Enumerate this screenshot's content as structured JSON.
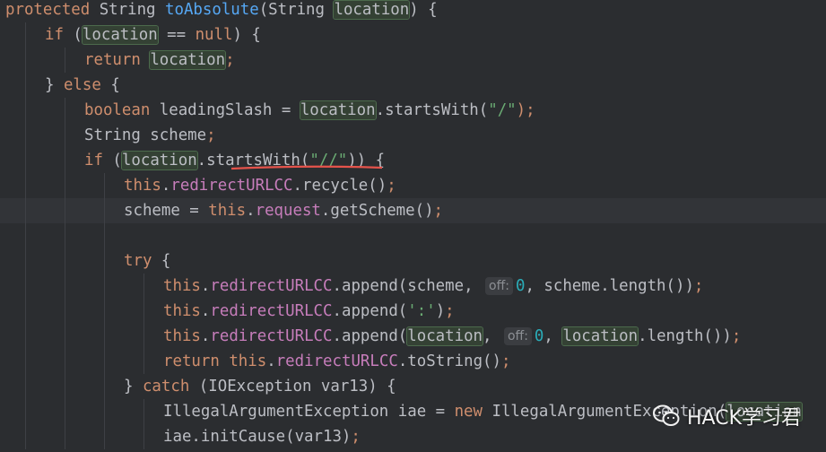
{
  "editor": {
    "lines": [
      {
        "indent": 0,
        "current": false,
        "tokens": [
          {
            "t": "protected",
            "c": "kw"
          },
          {
            "t": " String "
          },
          {
            "t": "toAbsolute",
            "c": "fn"
          },
          {
            "t": "(String "
          },
          {
            "t": "location",
            "c": "hl"
          },
          {
            "t": ") {"
          }
        ]
      },
      {
        "indent": 1,
        "current": false,
        "tokens": [
          {
            "t": "if",
            "c": "kw"
          },
          {
            "t": " ("
          },
          {
            "t": "location",
            "c": "hl"
          },
          {
            "t": " == "
          },
          {
            "t": "null",
            "c": "kw"
          },
          {
            "t": ") {"
          }
        ]
      },
      {
        "indent": 2,
        "current": false,
        "tokens": [
          {
            "t": "return",
            "c": "kw"
          },
          {
            "t": " "
          },
          {
            "t": "location",
            "c": "hl"
          },
          {
            "t": ";",
            "c": "kw"
          }
        ]
      },
      {
        "indent": 1,
        "current": false,
        "tokens": [
          {
            "t": "} "
          },
          {
            "t": "else",
            "c": "kw"
          },
          {
            "t": " {"
          }
        ]
      },
      {
        "indent": 2,
        "current": false,
        "tokens": [
          {
            "t": "boolean",
            "c": "kw"
          },
          {
            "t": " leadingSlash = "
          },
          {
            "t": "location",
            "c": "hl"
          },
          {
            "t": ".startsWith("
          },
          {
            "t": "\"/\"",
            "c": "str"
          },
          {
            "t": ");",
            "c": "kw"
          }
        ]
      },
      {
        "indent": 2,
        "current": false,
        "tokens": [
          {
            "t": "String scheme"
          },
          {
            "t": ";",
            "c": "kw"
          }
        ]
      },
      {
        "indent": 2,
        "current": false,
        "tokens": [
          {
            "t": "if",
            "c": "kw"
          },
          {
            "t": " ("
          },
          {
            "t": "location",
            "c": "hl"
          },
          {
            "t": ".startsWith("
          },
          {
            "t": "\"//\"",
            "c": "str"
          },
          {
            "t": ")) {"
          }
        ]
      },
      {
        "indent": 3,
        "current": false,
        "tokens": [
          {
            "t": "this",
            "c": "kw"
          },
          {
            "t": "."
          },
          {
            "t": "redirectURLCC",
            "c": "fld"
          },
          {
            "t": ".recycle()"
          },
          {
            "t": ";",
            "c": "kw"
          }
        ]
      },
      {
        "indent": 3,
        "current": true,
        "tokens": [
          {
            "t": "scheme = "
          },
          {
            "t": "this",
            "c": "kw"
          },
          {
            "t": "."
          },
          {
            "t": "request",
            "c": "fld"
          },
          {
            "t": ".getScheme()"
          },
          {
            "t": ";",
            "c": "kw"
          }
        ]
      },
      {
        "indent": 3,
        "current": false,
        "tokens": []
      },
      {
        "indent": 3,
        "current": false,
        "tokens": [
          {
            "t": "try",
            "c": "kw"
          },
          {
            "t": " {"
          }
        ]
      },
      {
        "indent": 4,
        "current": false,
        "tokens": [
          {
            "t": "this",
            "c": "kw"
          },
          {
            "t": "."
          },
          {
            "t": "redirectURLCC",
            "c": "fld"
          },
          {
            "t": ".append(scheme, "
          },
          {
            "t": "off:",
            "c": "hint"
          },
          {
            "t": "0",
            "c": "num"
          },
          {
            "t": ", scheme.length())"
          },
          {
            "t": ";",
            "c": "kw"
          }
        ]
      },
      {
        "indent": 4,
        "current": false,
        "tokens": [
          {
            "t": "this",
            "c": "kw"
          },
          {
            "t": "."
          },
          {
            "t": "redirectURLCC",
            "c": "fld"
          },
          {
            "t": ".append("
          },
          {
            "t": "':'",
            "c": "str"
          },
          {
            "t": ")"
          },
          {
            "t": ";",
            "c": "kw"
          }
        ]
      },
      {
        "indent": 4,
        "current": false,
        "tokens": [
          {
            "t": "this",
            "c": "kw"
          },
          {
            "t": "."
          },
          {
            "t": "redirectURLCC",
            "c": "fld"
          },
          {
            "t": ".append("
          },
          {
            "t": "location",
            "c": "hl"
          },
          {
            "t": ", "
          },
          {
            "t": "off:",
            "c": "hint"
          },
          {
            "t": "0",
            "c": "num"
          },
          {
            "t": ", "
          },
          {
            "t": "location",
            "c": "hl"
          },
          {
            "t": ".length())"
          },
          {
            "t": ";",
            "c": "kw"
          }
        ]
      },
      {
        "indent": 4,
        "current": false,
        "tokens": [
          {
            "t": "return",
            "c": "kw"
          },
          {
            "t": " "
          },
          {
            "t": "this",
            "c": "kw"
          },
          {
            "t": "."
          },
          {
            "t": "redirectURLCC",
            "c": "fld"
          },
          {
            "t": ".toString()"
          },
          {
            "t": ";",
            "c": "kw"
          }
        ]
      },
      {
        "indent": 3,
        "current": false,
        "tokens": [
          {
            "t": "} "
          },
          {
            "t": "catch",
            "c": "kw"
          },
          {
            "t": " (IOException var13) {"
          }
        ]
      },
      {
        "indent": 4,
        "current": false,
        "tokens": [
          {
            "t": "IllegalArgumentException iae = "
          },
          {
            "t": "new",
            "c": "kw"
          },
          {
            "t": " IllegalArgumentException("
          },
          {
            "t": "location",
            "c": "hl"
          }
        ]
      },
      {
        "indent": 4,
        "current": false,
        "tokens": [
          {
            "t": "iae.initCause(var13)"
          },
          {
            "t": ";",
            "c": "kw"
          }
        ]
      }
    ]
  },
  "watermark": {
    "label": "HACK学习君",
    "icon": "wechat-icon"
  },
  "colors": {
    "background": "#2b2d30",
    "keyword": "#cf8e6d",
    "method": "#56a8f5",
    "field": "#c77dbb",
    "string": "#6aab73",
    "number": "#2aacb8",
    "identifier_highlight": "#344134",
    "error_underline": "#e5534b"
  }
}
